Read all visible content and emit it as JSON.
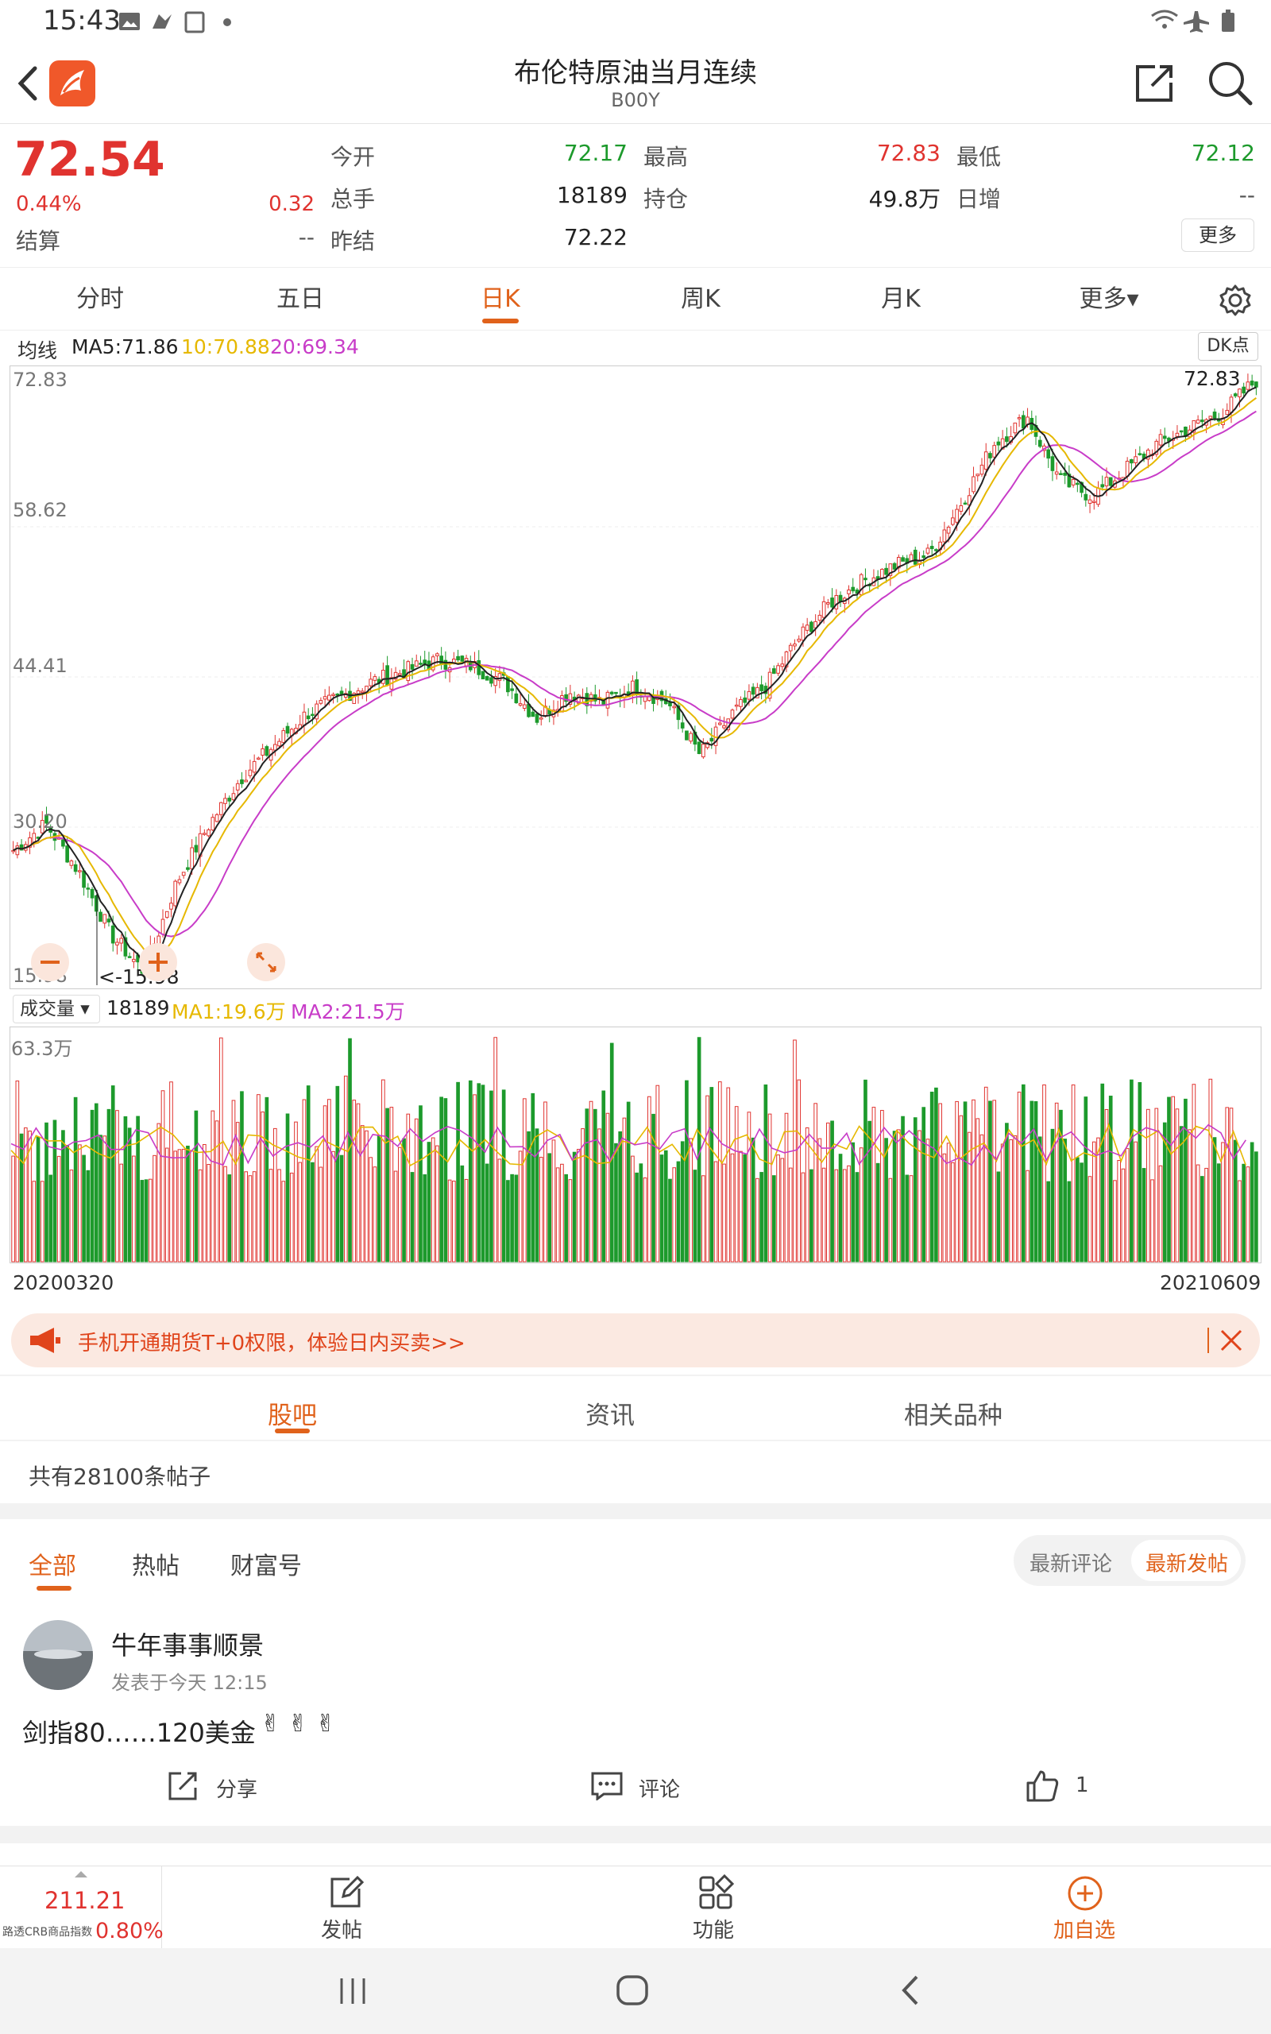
{
  "status": {
    "time": "15:43"
  },
  "header": {
    "title": "布伦特原油当月连续",
    "code": "B00Y"
  },
  "quote": {
    "price": "72.54",
    "change_pct": "0.44%",
    "change": "0.32",
    "settle_label": "结算",
    "settle_value": "--",
    "open_label": "今开",
    "open_value": "72.17",
    "high_label": "最高",
    "high_value": "72.83",
    "low_label": "最低",
    "low_value": "72.12",
    "volume_label": "总手",
    "volume_value": "18189",
    "oi_label": "持仓",
    "oi_value": "49.8万",
    "daily_inc_label": "日增",
    "daily_inc_value": "--",
    "prev_settle_label": "昨结",
    "prev_settle_value": "72.22",
    "more_label": "更多"
  },
  "ktabs": [
    "分时",
    "五日",
    "日K",
    "周K",
    "月K",
    "更多▾"
  ],
  "active_ktab": 2,
  "ma_legend": {
    "label": "均线",
    "ma5": "MA5:71.86",
    "ma10": "10:70.88",
    "ma20": "20:69.34",
    "dk": "DK点"
  },
  "vol_legend": {
    "label": "成交量 ▾",
    "value": "18189",
    "ma1": "MA1:19.6万",
    "ma2": "MA2:21.5万"
  },
  "colors": {
    "up": "#e0332f",
    "down": "#1d9a2c",
    "ma5": "#222222",
    "ma10": "#e6b800",
    "ma20": "#c83cc8",
    "accent": "#e0621b"
  },
  "chart_data": [
    {
      "type": "candlestick",
      "y_ticks": [
        "72.83",
        "58.62",
        "44.41",
        "30.20",
        "15.98"
      ],
      "ylim": [
        15.98,
        72.83
      ],
      "max_label": "72.83",
      "min_label": "<-15.98",
      "x_start": "20200320",
      "x_end": "20210609",
      "close_trend": [
        28.0,
        30.5,
        26.0,
        20.0,
        16.5,
        25.0,
        30.5,
        35.0,
        38.0,
        41.0,
        42.5,
        44.0,
        45.0,
        46.0,
        45.5,
        44.0,
        40.5,
        43.0,
        42.0,
        43.5,
        42.0,
        37.0,
        41.0,
        43.5,
        48.0,
        51.5,
        53.5,
        55.0,
        56.0,
        61.0,
        66.5,
        69.0,
        63.0,
        61.5,
        64.0,
        66.5,
        68.0,
        69.5,
        72.5
      ]
    },
    {
      "type": "bar",
      "title": "成交量",
      "y_ticks": [
        "63.3万"
      ],
      "ylim": [
        0,
        63.3
      ]
    }
  ],
  "banner": {
    "text": "手机开通期货T+0权限，体验日内买卖>>"
  },
  "section_tabs": [
    "股吧",
    "资讯",
    "相关品种"
  ],
  "post_count": "共有28100条帖子",
  "filter_tabs": [
    "全部",
    "热帖",
    "财富号"
  ],
  "sort_tabs": [
    "最新评论",
    "最新发帖"
  ],
  "post": {
    "author": "牛年事事顺景",
    "time": "发表于今天 12:15",
    "content": "剑指80……120美金",
    "share": "分享",
    "comment": "评论",
    "likes": "1"
  },
  "bottom": {
    "index_value": "211.21",
    "index_name": "路透CRB商品指数",
    "index_pct": "0.80%",
    "post_label": "发帖",
    "func_label": "功能",
    "add_label": "加自选"
  }
}
